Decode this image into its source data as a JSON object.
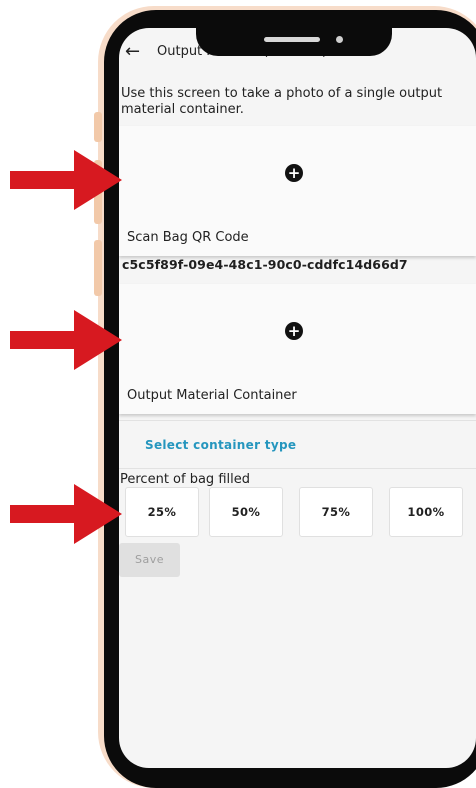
{
  "header": {
    "back_icon": "arrow-left-icon",
    "title": "Output Material (Discrete)"
  },
  "intro_text": "Use this screen to take a photo of a single output material container.",
  "scan_card": {
    "icon": "add-circle-icon",
    "label": "Scan Bag QR Code",
    "scanned_value": "c5c5f89f-09e4-48c1-90c0-cddfc14d66d7"
  },
  "container_card": {
    "icon": "add-circle-icon",
    "label": "Output Material Container"
  },
  "container_type": {
    "link_label": "Select container type"
  },
  "percent": {
    "label": "Percent of bag filled",
    "options": [
      "25%",
      "50%",
      "75%",
      "100%"
    ]
  },
  "save_label": "Save",
  "colors": {
    "arrow": "#d71920",
    "phone_frame": "#0b0b0b",
    "phone_edge": "#f7dcc9",
    "link": "#2596be"
  }
}
